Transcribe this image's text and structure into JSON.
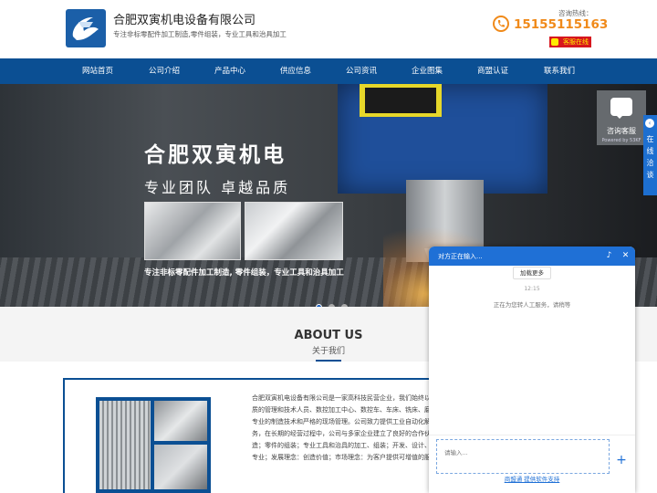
{
  "header": {
    "company_name": "合肥双寅机电设备有限公司",
    "slogan": "专注非标零配件加工制造,零件组装，专业工具和治具加工",
    "hotline_label": "咨询热线：",
    "hotline_number": "15155115163",
    "online_button": "客服在线"
  },
  "nav": {
    "items": [
      "网站首页",
      "公司介绍",
      "产品中心",
      "供应信息",
      "公司资讯",
      "企业图集",
      "商盟认证",
      "联系我们"
    ]
  },
  "banner": {
    "title": "合肥双寅机电",
    "subtitle": "专业团队 卓越品质",
    "caption": "专注非标零配件加工制造, 零件组装，专业工具和治具加工",
    "slides": 3,
    "active_slide": 1
  },
  "side": {
    "consult_label": "咨询客服",
    "powered": "Powered by 53KF",
    "online_tab": "在线洽谈"
  },
  "about": {
    "title": "ABOUT US",
    "subtitle": "关于我们",
    "paragraph_lines": [
      "合肥双寅机电设备有限公司是一家高科技民营企业，我们始终以",
      "质的管理和技术人员、数控加工中心、数控车、车床、铣床、磨",
      "专业的制造技术和严格的现场管理。公司致力提供工业自动化解",
      "务，在长期的经营过程中，公司与多家企业建立了良好的合作伙",
      "造；零件的组装；专业工具和治具的加工、组装；开发、设计、",
      "专业；发展理念：创造价值；市场理念：为客户提供可增值的服"
    ]
  },
  "chat": {
    "header_title": "对方正在输入...",
    "load_more": "加载更多",
    "time": "12:15",
    "system_message": "正在为您转人工服务，请稍等",
    "input_placeholder": "请输入...",
    "footer": "商盟通 提供软件支持"
  },
  "colors": {
    "nav_blue": "#0b4f93",
    "hotline_orange": "#f08a1a",
    "chat_blue": "#1f70d6",
    "online_red": "#d7161e"
  }
}
